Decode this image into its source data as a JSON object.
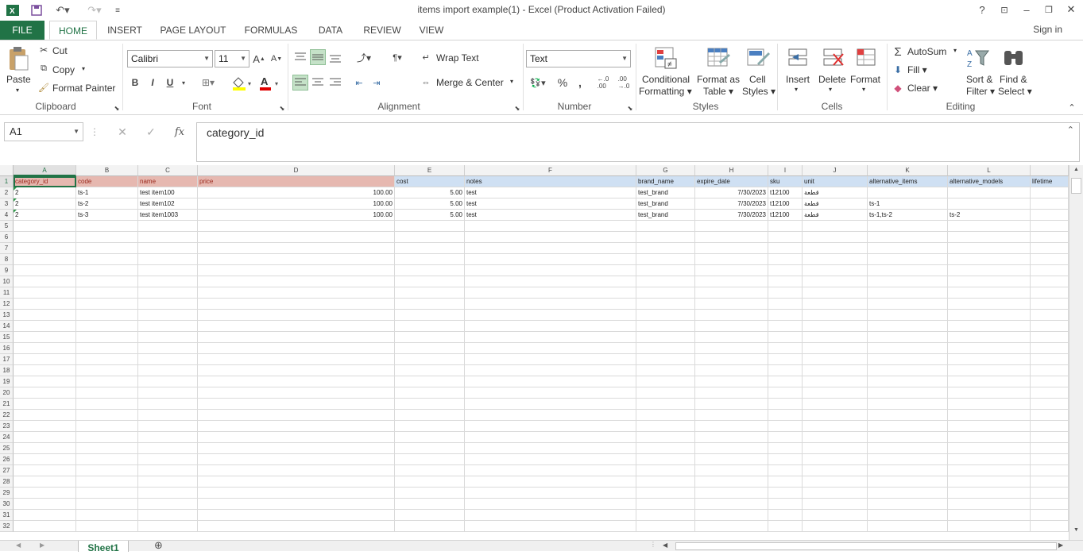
{
  "title_bar": {
    "title": "items import example(1) - Excel (Product Activation Failed)",
    "help": "?",
    "minimize": "–",
    "close": "✕"
  },
  "ribbon_tabs": [
    "FILE",
    "HOME",
    "INSERT",
    "PAGE LAYOUT",
    "FORMULAS",
    "DATA",
    "REVIEW",
    "VIEW"
  ],
  "sign_in": "Sign in",
  "clipboard": {
    "paste": "Paste",
    "cut": "Cut",
    "copy": "Copy",
    "format_painter": "Format Painter",
    "label": "Clipboard"
  },
  "font": {
    "name": "Calibri",
    "size": "11",
    "bold": "B",
    "italic": "I",
    "underline": "U",
    "label": "Font"
  },
  "alignment": {
    "wrap_text": "Wrap Text",
    "merge_center": "Merge & Center",
    "label": "Alignment"
  },
  "number": {
    "format": "Text",
    "percent": "%",
    "comma": ",",
    "label": "Number"
  },
  "styles": {
    "conditional": "Conditional",
    "formatting": "Formatting",
    "format_as": "Format as",
    "table": "Table",
    "cell": "Cell",
    "cell_styles": "Styles",
    "label": "Styles"
  },
  "cells": {
    "insert": "Insert",
    "delete": "Delete",
    "format": "Format",
    "label": "Cells"
  },
  "editing": {
    "autosum": "AutoSum",
    "fill": "Fill",
    "clear": "Clear",
    "sort": "Sort &",
    "filter": "Filter",
    "find": "Find &",
    "select": "Select",
    "label": "Editing"
  },
  "formula_bar": {
    "name_box": "A1",
    "fx": "fx",
    "content": "category_id"
  },
  "columns": [
    "A",
    "B",
    "C",
    "D",
    "E",
    "F",
    "G",
    "H",
    "I",
    "J",
    "K",
    "L",
    ""
  ],
  "header_row": [
    "category_id",
    "code",
    "name",
    "price",
    "cost",
    "notes",
    "brand_name",
    "expire_date",
    "sku",
    "unit",
    "alternative_items",
    "alternative_models",
    "lifetime"
  ],
  "rows": [
    [
      "2",
      "ts-1",
      "test item100",
      "100.00",
      "5.00",
      "test",
      "test_brand",
      "7/30/2023",
      "t12100",
      "قطعة",
      "",
      "",
      ""
    ],
    [
      "2",
      "ts-2",
      "test item102",
      "100.00",
      "5.00",
      "test",
      "test_brand",
      "7/30/2023",
      "t12100",
      "قطعة",
      "ts-1",
      "",
      ""
    ],
    [
      "2",
      "ts-3",
      "test item1003",
      "100.00",
      "5.00",
      "test",
      "test_brand",
      "7/30/2023",
      "t12100",
      "قطعة",
      "ts-1,ts-2",
      "ts-2",
      ""
    ]
  ],
  "row_numbers": [
    "1",
    "2",
    "3",
    "4",
    "5",
    "6",
    "7",
    "8",
    "9",
    "10",
    "11",
    "12",
    "13",
    "14",
    "15",
    "16",
    "17",
    "18",
    "19",
    "20",
    "21",
    "22",
    "23",
    "24",
    "25",
    "26",
    "27",
    "28",
    "29",
    "30",
    "31",
    "32"
  ],
  "sheet_tab": "Sheet1",
  "colors": {
    "accent": "#217346",
    "header_red": "#e6b8b0",
    "header_blue": "#cfe0f3",
    "arrow": "#e00000"
  }
}
